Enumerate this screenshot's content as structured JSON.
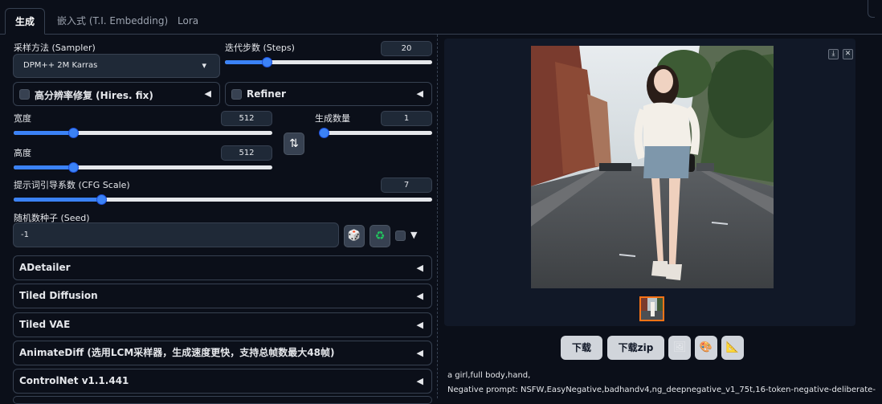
{
  "tabs": [
    {
      "label": "生成"
    },
    {
      "label": "嵌入式 (T.I. Embedding)"
    },
    {
      "label": "Lora"
    }
  ],
  "sampler": {
    "label": "采样方法 (Sampler)",
    "value": "DPM++ 2M Karras"
  },
  "steps": {
    "label": "迭代步数 (Steps)",
    "value": "20",
    "fraction": 0.2
  },
  "hires": {
    "label": "高分辨率修复 (Hires. fix)"
  },
  "refiner": {
    "label": "Refiner"
  },
  "width": {
    "label": "宽度",
    "value": "512",
    "fraction": 0.23
  },
  "height": {
    "label": "高度",
    "value": "512",
    "fraction": 0.23
  },
  "batch": {
    "label": "生成数量",
    "value": "1",
    "fraction": 0.0
  },
  "cfg": {
    "label": "提示词引导系数 (CFG Scale)",
    "value": "7",
    "fraction": 0.21
  },
  "seed": {
    "label": "随机数种子 (Seed)",
    "value": "-1"
  },
  "accordions": [
    {
      "label": "ADetailer"
    },
    {
      "label": "Tiled Diffusion"
    },
    {
      "label": "Tiled VAE"
    },
    {
      "label": "AnimateDiff (选用LCM采样器，生成速度更快，支持总帧数最大48帧)"
    },
    {
      "label": "ControlNet v1.1.441"
    }
  ],
  "output": {
    "download_label": "下载",
    "download_zip_label": "下载zip",
    "prompt_text": "a girl,full body,hand,",
    "negative_text": "Negative prompt: NSFW,EasyNegative,badhandv4,ng_deepnegative_v1_75t,16-token-negative-deliberate-"
  },
  "icons": {
    "dropdown": "▾",
    "swap": "⇅",
    "dice": "🎲",
    "recycle": "♻",
    "triangle_left": "◀",
    "triangle_down": "▼",
    "download_small": "⤓",
    "close": "✕",
    "image": "🖼",
    "palette": "🎨",
    "ruler": "📐"
  },
  "colors": {
    "accent": "#3b82f6",
    "background": "#0b0f19",
    "selected_thumb": "#f97316"
  }
}
